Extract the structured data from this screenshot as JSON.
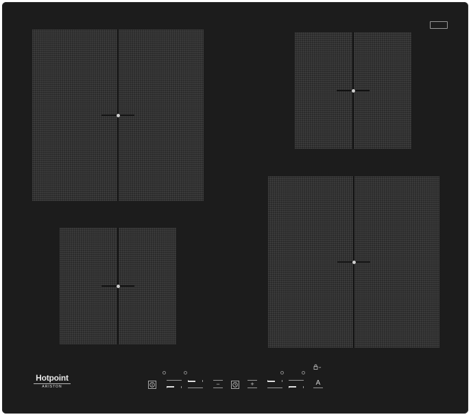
{
  "brand": {
    "name": "Hotpoint",
    "sub": "ARISTON"
  },
  "controls": {
    "minus_glyph": "−",
    "plus_glyph": "+",
    "auto_glyph": "A",
    "lock_glyph": "🔒"
  },
  "sliders": {
    "left_front_level": 0.5,
    "left_rear_level": 0.5,
    "right_front_level": 0.5,
    "right_rear_level": 0.5
  },
  "colors": {
    "surface": "#1c1c1c",
    "zone": "#2b2b2b",
    "markings": "#c8c8c8"
  }
}
